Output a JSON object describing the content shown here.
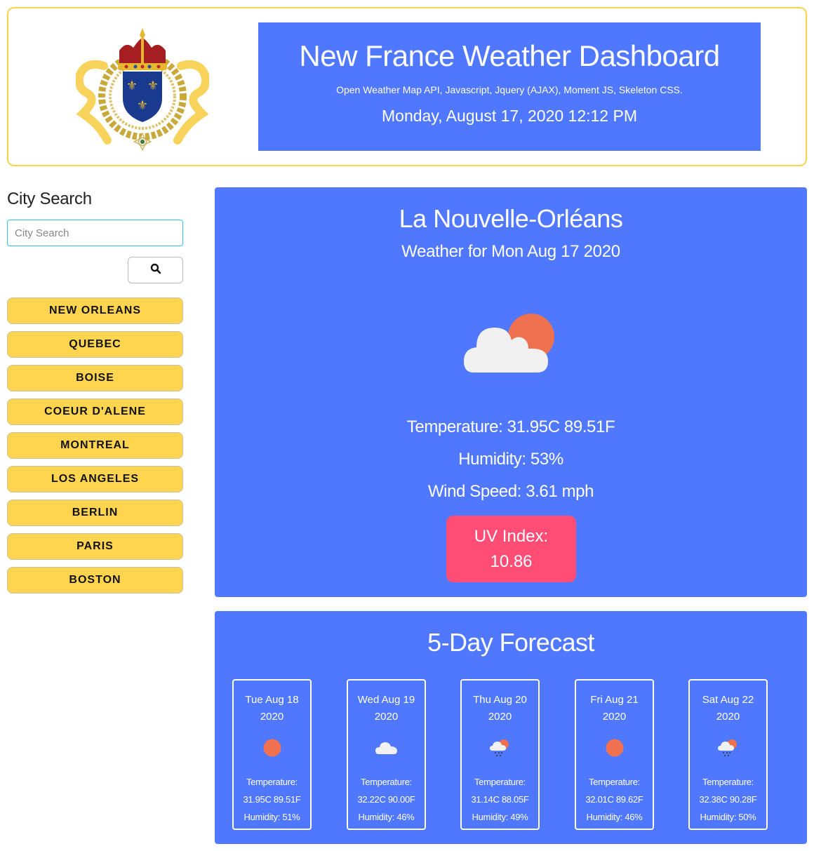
{
  "header": {
    "crest_alt": "Royal coat of arms of New France",
    "title": "New France Weather Dashboard",
    "subtitle": "Open Weather Map API, Javascript, Jquery (AJAX), Moment JS, Skeleton CSS.",
    "datetime": "Monday, August 17, 2020 12:12 PM"
  },
  "sidebar": {
    "title": "City Search",
    "search_placeholder": "City Search",
    "search_value": "",
    "search_button_icon": "search-icon",
    "cities": [
      "NEW ORLEANS",
      "QUEBEC",
      "BOISE",
      "COEUR D'ALENE",
      "MONTREAL",
      "LOS ANGELES",
      "BERLIN",
      "PARIS",
      "BOSTON"
    ]
  },
  "current": {
    "city": "La Nouvelle-Orléans",
    "date": "Weather for Mon Aug 17 2020",
    "icon": "partly-cloudy-icon",
    "temperature": "Temperature: 31.95C 89.51F",
    "humidity": "Humidity: 53%",
    "wind": "Wind Speed: 3.61 mph",
    "uv_label": "UV Index:",
    "uv_value": "10.86"
  },
  "forecast": {
    "title": "5-Day Forecast",
    "days": [
      {
        "date": "Tue Aug 18",
        "year": "2020",
        "icon": "sun-icon",
        "temp_label": "Temperature:",
        "temp": "31.95C 89.51F",
        "humidity": "Humidity: 51%"
      },
      {
        "date": "Wed Aug 19",
        "year": "2020",
        "icon": "cloud-icon",
        "temp_label": "Temperature:",
        "temp": "32.22C 90.00F",
        "humidity": "Humidity: 46%"
      },
      {
        "date": "Thu Aug 20",
        "year": "2020",
        "icon": "rain-sun-icon",
        "temp_label": "Temperature:",
        "temp": "31.14C 88.05F",
        "humidity": "Humidity: 49%"
      },
      {
        "date": "Fri Aug 21",
        "year": "2020",
        "icon": "sun-icon",
        "temp_label": "Temperature:",
        "temp": "32.01C 89.62F",
        "humidity": "Humidity: 46%"
      },
      {
        "date": "Sat Aug 22",
        "year": "2020",
        "icon": "rain-sun-icon",
        "temp_label": "Temperature:",
        "temp": "32.38C 90.28F",
        "humidity": "Humidity: 50%"
      }
    ]
  },
  "colors": {
    "panel_blue": "#5078fe",
    "header_border": "#fcd34d",
    "city_button": "#ffd54f",
    "uv_high": "#ff4d75",
    "sun": "#ef714f",
    "cloud": "#f1f1f1"
  }
}
